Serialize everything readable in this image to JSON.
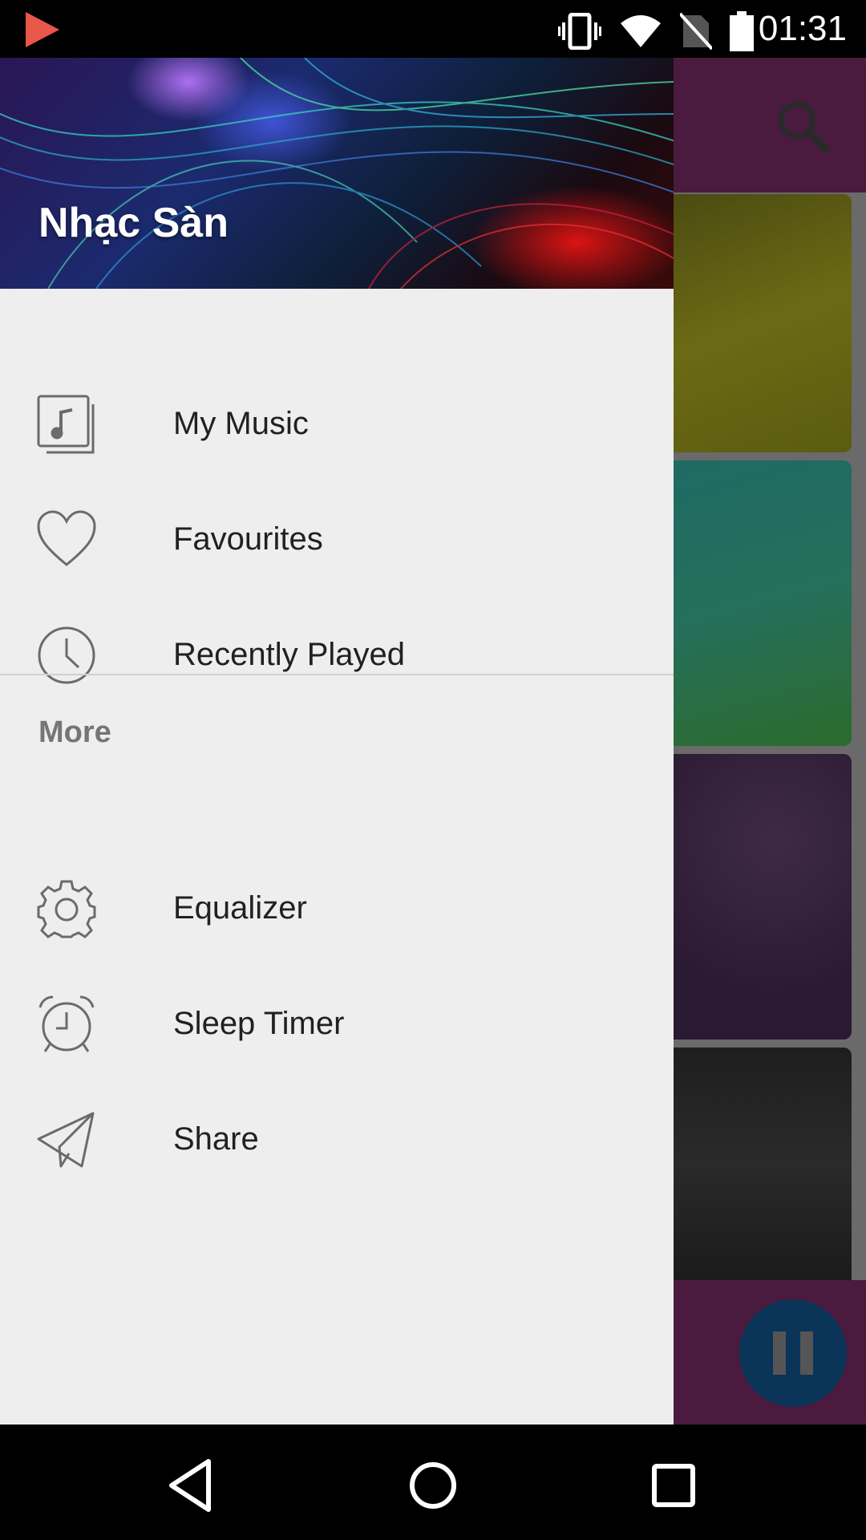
{
  "status_bar": {
    "time": "01:31",
    "icons": [
      "play-store-icon",
      "vibrate-icon",
      "wifi-icon",
      "no-sim-icon",
      "battery-icon"
    ]
  },
  "drawer": {
    "title": "Nhạc Sàn",
    "items": [
      {
        "label": "My Music",
        "icon": "music-library-icon"
      },
      {
        "label": "Favourites",
        "icon": "heart-icon"
      },
      {
        "label": "Recently Played",
        "icon": "clock-icon"
      }
    ],
    "section_header": "More",
    "more_items": [
      {
        "label": "Equalizer",
        "icon": "gear-icon"
      },
      {
        "label": "Sleep Timer",
        "icon": "alarm-clock-icon"
      },
      {
        "label": "Share",
        "icon": "paper-plane-icon"
      }
    ]
  },
  "background_app": {
    "toolbar_icon": "search-icon",
    "player_button": "pause-icon"
  },
  "nav_bar": {
    "buttons": [
      "back-icon",
      "home-icon",
      "recents-icon"
    ]
  },
  "colors": {
    "drawer_bg": "#eeeeee",
    "toolbar_bg": "#4a1b3e",
    "pause_button": "#0a3458",
    "app_icon": "#e8574a"
  }
}
